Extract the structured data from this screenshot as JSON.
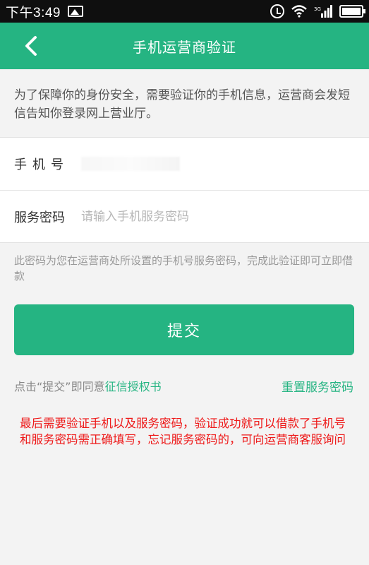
{
  "status_bar": {
    "time": "下午3:49",
    "network": "3G"
  },
  "app_bar": {
    "title": "手机运营商验证",
    "back_icon": "chevron-left-icon"
  },
  "intro_text": "为了保障你的身份安全，需要验证你的手机信息，运营商会发短信告知你登录网上营业厅。",
  "form": {
    "phone_label": "手机号",
    "phone_value": "",
    "password_label": "服务密码",
    "password_placeholder": "请输入手机服务密码"
  },
  "hint_text": "此密码为您在运营商处所设置的手机号服务密码，完成此验证即可立即借款",
  "submit_label": "提交",
  "agreement": {
    "prefix": "点击“提交”即同意",
    "link": "征信授权书"
  },
  "reset_link": "重置服务密码",
  "annotation": "最后需要验证手机以及服务密码，验证成功就可以借款了手机号和服务密码需正确填写，忘记服务密码的，可向运营商客服询问",
  "colors": {
    "accent": "#25b482",
    "annotation": "#ee1a1a"
  }
}
